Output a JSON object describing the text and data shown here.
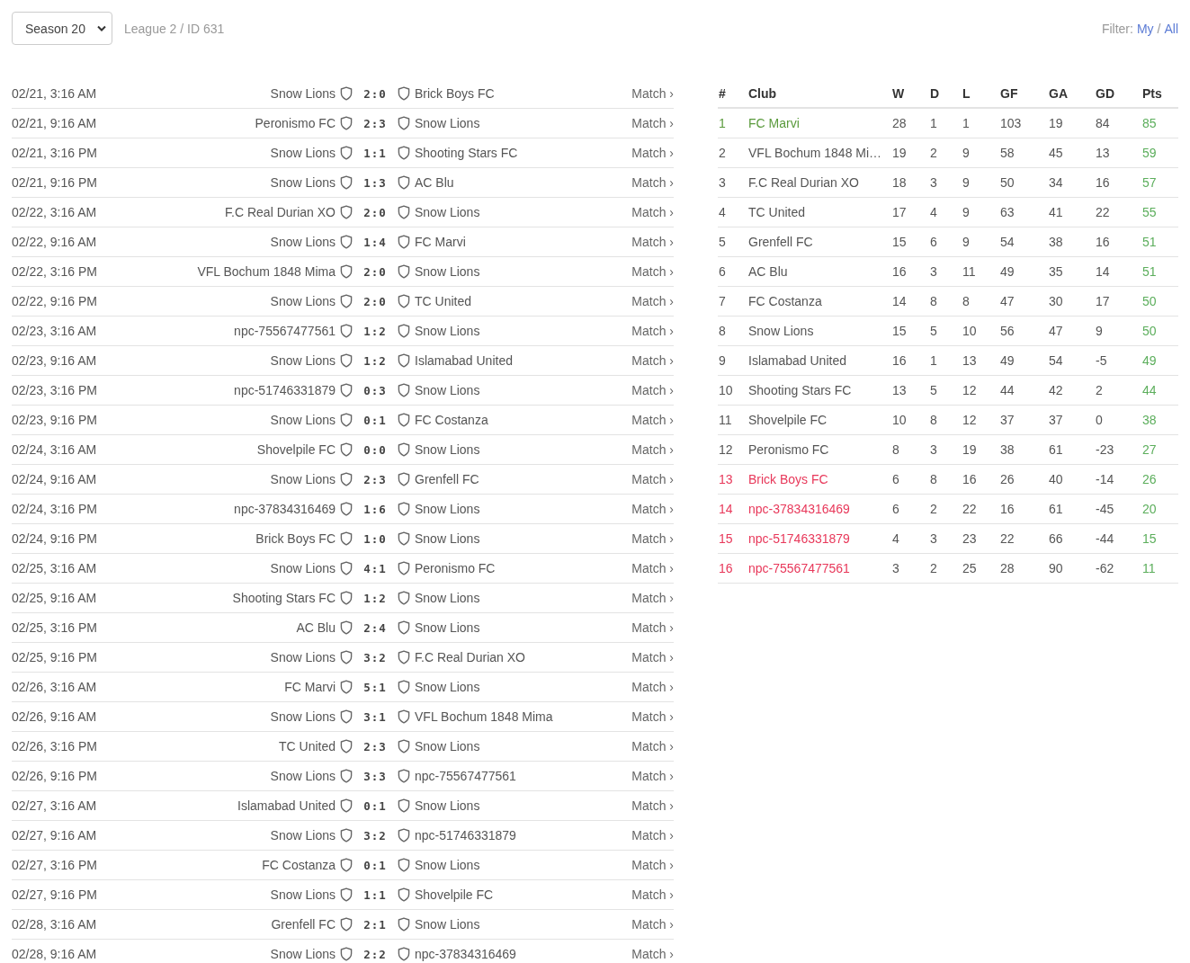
{
  "toolbar": {
    "season": "Season 20",
    "breadcrumb": "League 2 / ID 631",
    "filter_label": "Filter:",
    "filter_options": [
      {
        "label": "My",
        "selected": false
      },
      {
        "label": "All",
        "selected": false
      }
    ],
    "filter_separator": "/"
  },
  "fixtures": [
    {
      "date": "02/21, 3:16 AM",
      "home": "Snow Lions",
      "score": "2:0",
      "away": "Brick Boys FC",
      "link": "Match ›"
    },
    {
      "date": "02/21, 9:16 AM",
      "home": "Peronismo FC",
      "score": "2:3",
      "away": "Snow Lions",
      "link": "Match ›"
    },
    {
      "date": "02/21, 3:16 PM",
      "home": "Snow Lions",
      "score": "1:1",
      "away": "Shooting Stars FC",
      "link": "Match ›"
    },
    {
      "date": "02/21, 9:16 PM",
      "home": "Snow Lions",
      "score": "1:3",
      "away": "AC Blu",
      "link": "Match ›"
    },
    {
      "date": "02/22, 3:16 AM",
      "home": "F.C Real Durian XO",
      "score": "2:0",
      "away": "Snow Lions",
      "link": "Match ›"
    },
    {
      "date": "02/22, 9:16 AM",
      "home": "Snow Lions",
      "score": "1:4",
      "away": "FC Marvi",
      "link": "Match ›"
    },
    {
      "date": "02/22, 3:16 PM",
      "home": "VFL Bochum 1848 Mima",
      "score": "2:0",
      "away": "Snow Lions",
      "link": "Match ›"
    },
    {
      "date": "02/22, 9:16 PM",
      "home": "Snow Lions",
      "score": "2:0",
      "away": "TC United",
      "link": "Match ›"
    },
    {
      "date": "02/23, 3:16 AM",
      "home": "npc-75567477561",
      "score": "1:2",
      "away": "Snow Lions",
      "link": "Match ›"
    },
    {
      "date": "02/23, 9:16 AM",
      "home": "Snow Lions",
      "score": "1:2",
      "away": "Islamabad United",
      "link": "Match ›"
    },
    {
      "date": "02/23, 3:16 PM",
      "home": "npc-51746331879",
      "score": "0:3",
      "away": "Snow Lions",
      "link": "Match ›"
    },
    {
      "date": "02/23, 9:16 PM",
      "home": "Snow Lions",
      "score": "0:1",
      "away": "FC Costanza",
      "link": "Match ›"
    },
    {
      "date": "02/24, 3:16 AM",
      "home": "Shovelpile FC",
      "score": "0:0",
      "away": "Snow Lions",
      "link": "Match ›"
    },
    {
      "date": "02/24, 9:16 AM",
      "home": "Snow Lions",
      "score": "2:3",
      "away": "Grenfell FC",
      "link": "Match ›"
    },
    {
      "date": "02/24, 3:16 PM",
      "home": "npc-37834316469",
      "score": "1:6",
      "away": "Snow Lions",
      "link": "Match ›"
    },
    {
      "date": "02/24, 9:16 PM",
      "home": "Brick Boys FC",
      "score": "1:0",
      "away": "Snow Lions",
      "link": "Match ›"
    },
    {
      "date": "02/25, 3:16 AM",
      "home": "Snow Lions",
      "score": "4:1",
      "away": "Peronismo FC",
      "link": "Match ›"
    },
    {
      "date": "02/25, 9:16 AM",
      "home": "Shooting Stars FC",
      "score": "1:2",
      "away": "Snow Lions",
      "link": "Match ›"
    },
    {
      "date": "02/25, 3:16 PM",
      "home": "AC Blu",
      "score": "2:4",
      "away": "Snow Lions",
      "link": "Match ›"
    },
    {
      "date": "02/25, 9:16 PM",
      "home": "Snow Lions",
      "score": "3:2",
      "away": "F.C Real Durian XO",
      "link": "Match ›"
    },
    {
      "date": "02/26, 3:16 AM",
      "home": "FC Marvi",
      "score": "5:1",
      "away": "Snow Lions",
      "link": "Match ›"
    },
    {
      "date": "02/26, 9:16 AM",
      "home": "Snow Lions",
      "score": "3:1",
      "away": "VFL Bochum 1848 Mima",
      "link": "Match ›"
    },
    {
      "date": "02/26, 3:16 PM",
      "home": "TC United",
      "score": "2:3",
      "away": "Snow Lions",
      "link": "Match ›"
    },
    {
      "date": "02/26, 9:16 PM",
      "home": "Snow Lions",
      "score": "3:3",
      "away": "npc-75567477561",
      "link": "Match ›"
    },
    {
      "date": "02/27, 3:16 AM",
      "home": "Islamabad United",
      "score": "0:1",
      "away": "Snow Lions",
      "link": "Match ›"
    },
    {
      "date": "02/27, 9:16 AM",
      "home": "Snow Lions",
      "score": "3:2",
      "away": "npc-51746331879",
      "link": "Match ›"
    },
    {
      "date": "02/27, 3:16 PM",
      "home": "FC Costanza",
      "score": "0:1",
      "away": "Snow Lions",
      "link": "Match ›"
    },
    {
      "date": "02/27, 9:16 PM",
      "home": "Snow Lions",
      "score": "1:1",
      "away": "Shovelpile FC",
      "link": "Match ›"
    },
    {
      "date": "02/28, 3:16 AM",
      "home": "Grenfell FC",
      "score": "2:1",
      "away": "Snow Lions",
      "link": "Match ›"
    },
    {
      "date": "02/28, 9:16 AM",
      "home": "Snow Lions",
      "score": "2:2",
      "away": "npc-37834316469",
      "link": "Match ›"
    }
  ],
  "standings": {
    "columns": [
      "#",
      "Club",
      "W",
      "D",
      "L",
      "GF",
      "GA",
      "GD",
      "Pts"
    ],
    "rows": [
      {
        "color": "#5a9a3c",
        "cells": [
          "1",
          "FC Marvi",
          "28",
          "1",
          "1",
          "103",
          "19",
          "84",
          "85"
        ]
      },
      {
        "color": "#555555",
        "cells": [
          "2",
          "VFL Bochum 1848 Mi…",
          "19",
          "2",
          "9",
          "58",
          "45",
          "13",
          "59"
        ]
      },
      {
        "color": "#555555",
        "cells": [
          "3",
          "F.C Real Durian XO",
          "18",
          "3",
          "9",
          "50",
          "34",
          "16",
          "57"
        ]
      },
      {
        "color": "#555555",
        "cells": [
          "4",
          "TC United",
          "17",
          "4",
          "9",
          "63",
          "41",
          "22",
          "55"
        ]
      },
      {
        "color": "#555555",
        "cells": [
          "5",
          "Grenfell FC",
          "15",
          "6",
          "9",
          "54",
          "38",
          "16",
          "51"
        ]
      },
      {
        "color": "#555555",
        "cells": [
          "6",
          "AC Blu",
          "16",
          "3",
          "11",
          "49",
          "35",
          "14",
          "51"
        ]
      },
      {
        "color": "#555555",
        "cells": [
          "7",
          "FC Costanza",
          "14",
          "8",
          "8",
          "47",
          "30",
          "17",
          "50"
        ]
      },
      {
        "color": "#555555",
        "cells": [
          "8",
          "Snow Lions",
          "15",
          "5",
          "10",
          "56",
          "47",
          "9",
          "50"
        ]
      },
      {
        "color": "#555555",
        "cells": [
          "9",
          "Islamabad United",
          "16",
          "1",
          "13",
          "49",
          "54",
          "-5",
          "49"
        ]
      },
      {
        "color": "#555555",
        "cells": [
          "10",
          "Shooting Stars FC",
          "13",
          "5",
          "12",
          "44",
          "42",
          "2",
          "44"
        ]
      },
      {
        "color": "#555555",
        "cells": [
          "11",
          "Shovelpile FC",
          "10",
          "8",
          "12",
          "37",
          "37",
          "0",
          "38"
        ]
      },
      {
        "color": "#555555",
        "cells": [
          "12",
          "Peronismo FC",
          "8",
          "3",
          "19",
          "38",
          "61",
          "-23",
          "27"
        ]
      },
      {
        "color": "#e8385a",
        "cells": [
          "13",
          "Brick Boys FC",
          "6",
          "8",
          "16",
          "26",
          "40",
          "-14",
          "26"
        ]
      },
      {
        "color": "#e8385a",
        "cells": [
          "14",
          "npc-37834316469",
          "6",
          "2",
          "22",
          "16",
          "61",
          "-45",
          "20"
        ]
      },
      {
        "color": "#e8385a",
        "cells": [
          "15",
          "npc-51746331879",
          "4",
          "3",
          "23",
          "22",
          "66",
          "-44",
          "15"
        ]
      },
      {
        "color": "#e8385a",
        "cells": [
          "16",
          "npc-75567477561",
          "3",
          "2",
          "25",
          "28",
          "90",
          "-62",
          "11"
        ]
      }
    ]
  }
}
